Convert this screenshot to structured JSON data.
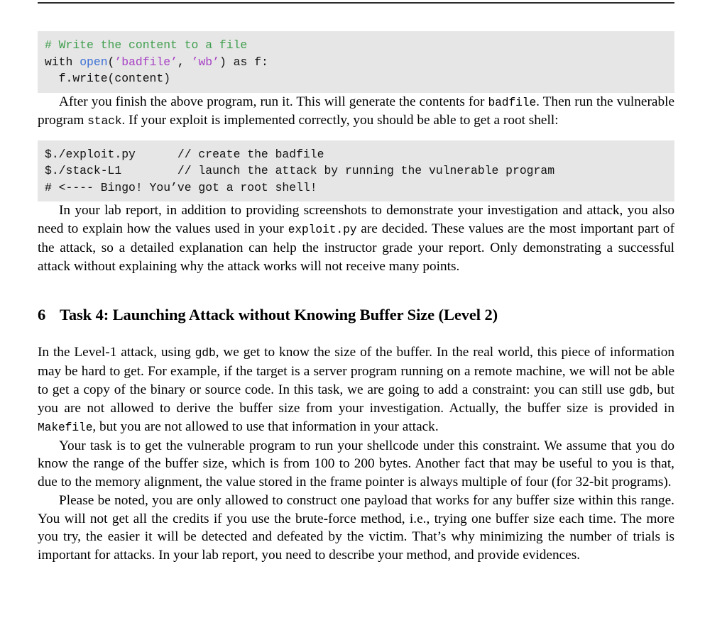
{
  "document": {
    "header_rule": true,
    "colors": {
      "code_background": "#e6e6e6",
      "comment_green": "#3f9e4d",
      "function_blue": "#3b6fd4",
      "string_purple": "#a63fc4",
      "text_black": "#000000",
      "rule_gray": "#2b2b2b"
    }
  },
  "code_block_1": {
    "language": "python",
    "lines": [
      {
        "tokens": [
          {
            "text": "# Write the content to a file",
            "style": "comment"
          }
        ]
      },
      {
        "tokens": [
          {
            "text": "with ",
            "style": "plain"
          },
          {
            "text": "open",
            "style": "func"
          },
          {
            "text": "(",
            "style": "plain"
          },
          {
            "text": "’badfile’",
            "style": "string"
          },
          {
            "text": ", ",
            "style": "plain"
          },
          {
            "text": "’wb’",
            "style": "string"
          },
          {
            "text": ") as f:",
            "style": "plain"
          }
        ]
      },
      {
        "tokens": [
          {
            "text": "  f.write(content)",
            "style": "plain"
          }
        ]
      }
    ]
  },
  "paragraph_1": {
    "segments": [
      {
        "text": "After you finish the above program, run it. This will generate the contents for ",
        "style": "body"
      },
      {
        "text": "badfile",
        "style": "mono"
      },
      {
        "text": ". Then run the vulnerable program ",
        "style": "body"
      },
      {
        "text": "stack",
        "style": "mono"
      },
      {
        "text": ". If your exploit is implemented correctly, you should be able to get a root shell:",
        "style": "body"
      }
    ]
  },
  "code_block_2": {
    "language": "shell",
    "lines": [
      {
        "tokens": [
          {
            "text": "$./exploit.py      // create the badfile",
            "style": "plain"
          }
        ]
      },
      {
        "tokens": [
          {
            "text": "$./stack-L1        // launch the attack by running the vulnerable program",
            "style": "plain"
          }
        ]
      },
      {
        "tokens": [
          {
            "text": "# <---- Bingo! You’ve got a root shell!",
            "style": "plain"
          }
        ]
      }
    ]
  },
  "paragraph_2": {
    "segments": [
      {
        "text": "In your lab report, in addition to providing screenshots to demonstrate your investigation and attack, you also need to explain how the values used in your ",
        "style": "body"
      },
      {
        "text": "exploit.py",
        "style": "mono"
      },
      {
        "text": " are decided.  These values are the most important part of the attack, so a detailed explanation can help the instructor grade your report. Only demonstrating a successful attack without explaining why the attack works will not receive many points.",
        "style": "body"
      }
    ]
  },
  "section_heading": {
    "number": "6",
    "title": "Task 4: Launching Attack without Knowing Buffer Size (Level 2)"
  },
  "paragraph_3": {
    "segments": [
      {
        "text": "In the Level-1 attack, using ",
        "style": "body"
      },
      {
        "text": "gdb",
        "style": "mono"
      },
      {
        "text": ", we get to know the size of the buffer.  In the real world, this piece of information may be hard to get. For example, if the target is a server program running on a remote machine, we will not be able to get a copy of the binary or source code. In this task, we are going to add a constraint: you can still use ",
        "style": "body"
      },
      {
        "text": "gdb",
        "style": "mono"
      },
      {
        "text": ", but you are not allowed to derive the buffer size from your investigation.  Actually, the buffer size is provided in ",
        "style": "body"
      },
      {
        "text": "Makefile",
        "style": "mono"
      },
      {
        "text": ", but you are not allowed to use that information in your attack.",
        "style": "body"
      }
    ]
  },
  "paragraph_4": {
    "segments": [
      {
        "text": "Your task is to get the vulnerable program to run your shellcode under this constraint.  We assume that you do know the range of the buffer size, which is from 100 to 200 bytes.  Another fact that may be useful to you is that, due to the memory alignment, the value stored in the frame pointer is always multiple of four (for 32-bit programs).",
        "style": "body"
      }
    ]
  },
  "paragraph_5": {
    "segments": [
      {
        "text": "Please be noted, you are only allowed to construct one payload that works for any buffer size within this range.  You will not get all the credits if you use the brute-force method, i.e., trying one buffer size each time. The more you try, the easier it will be detected and defeated by the victim. That’s why minimizing the number of trials is important for attacks. In your lab report, you need to describe your method, and provide evidences.",
        "style": "body"
      }
    ]
  }
}
